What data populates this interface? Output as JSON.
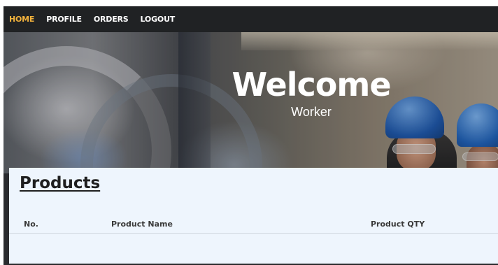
{
  "nav": {
    "items": [
      {
        "label": "HOME",
        "active": true
      },
      {
        "label": "PROFILE",
        "active": false
      },
      {
        "label": "ORDERS",
        "active": false
      },
      {
        "label": "LOGOUT",
        "active": false
      }
    ]
  },
  "hero": {
    "title": "Welcome",
    "subtitle": "Worker"
  },
  "products": {
    "title": "Products",
    "columns": [
      "No.",
      "Product Name",
      "Product QTY"
    ],
    "rows": []
  },
  "colors": {
    "nav_background": "#202224",
    "nav_active": "#f2b23c",
    "panel_background": "#eef5fd"
  }
}
